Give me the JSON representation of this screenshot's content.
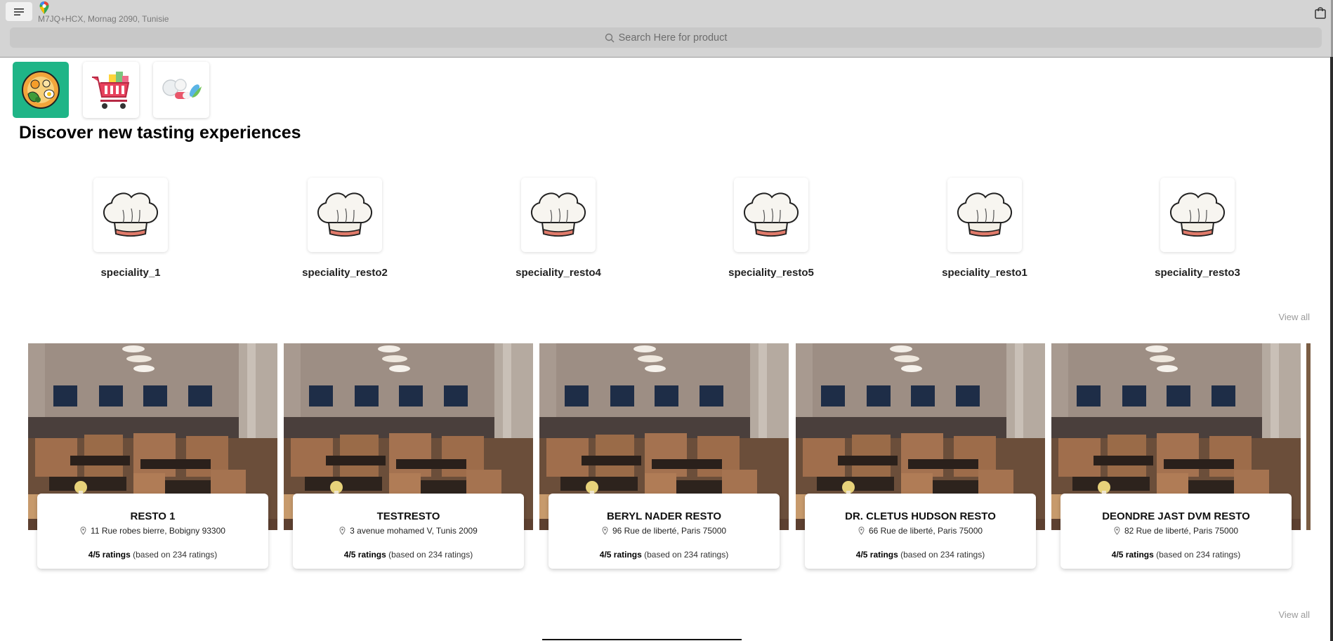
{
  "header": {
    "menu_icon": "hamburger-icon",
    "location_icon": "google-maps-pin-icon",
    "address": "M7JQ+HCX, Mornag 2090, Tunisie",
    "cart_icon": "shopping-bag-icon"
  },
  "search": {
    "icon": "search-icon",
    "placeholder": "Search Here for product"
  },
  "categories": [
    {
      "icon": "food-plate-icon",
      "active": true
    },
    {
      "icon": "grocery-cart-icon",
      "active": false
    },
    {
      "icon": "pharmacy-pills-icon",
      "active": false
    }
  ],
  "section": {
    "title": "Discover new tasting experiences"
  },
  "specialities": [
    {
      "label": "speciality_1",
      "icon": "chef-hat-icon"
    },
    {
      "label": "speciality_resto2",
      "icon": "chef-hat-icon"
    },
    {
      "label": "speciality_resto4",
      "icon": "chef-hat-icon"
    },
    {
      "label": "speciality_resto5",
      "icon": "chef-hat-icon"
    },
    {
      "label": "speciality_resto1",
      "icon": "chef-hat-icon"
    },
    {
      "label": "speciality_resto3",
      "icon": "chef-hat-icon"
    }
  ],
  "view_all_label": "View all",
  "restaurants": [
    {
      "name": "RESTO 1",
      "address": "11 Rue robes bierre, Bobigny 93300",
      "rating": "4/5 ratings",
      "based_on": "(based on 234 ratings)"
    },
    {
      "name": "TESTRESTO",
      "address": "3 avenue mohamed V, Tunis 2009",
      "rating": "4/5 ratings",
      "based_on": "(based on 234 ratings)"
    },
    {
      "name": "BERYL NADER RESTO",
      "address": "96 Rue de liberté, Paris 75000",
      "rating": "4/5 ratings",
      "based_on": "(based on 234 ratings)"
    },
    {
      "name": "DR. CLETUS HUDSON RESTO",
      "address": "66 Rue de liberté, Paris 75000",
      "rating": "4/5 ratings",
      "based_on": "(based on 234 ratings)"
    },
    {
      "name": "DEONDRE JAST DVM RESTO",
      "address": "82 Rue de liberté, Paris 75000",
      "rating": "4/5 ratings",
      "based_on": "(based on 234 ratings)"
    }
  ],
  "colors": {
    "header_bg": "#d4d4d4",
    "search_bg": "#c8c8c8",
    "active_category": "#1fb587",
    "muted_text": "#9a9a9a"
  }
}
